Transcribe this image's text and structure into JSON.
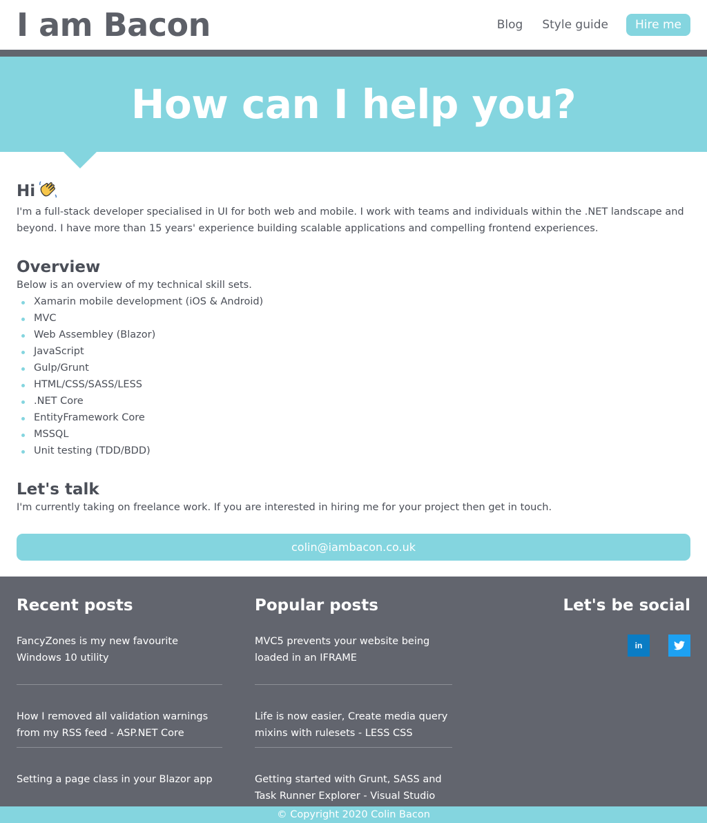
{
  "header": {
    "logo": "I am Bacon",
    "nav": {
      "blog": "Blog",
      "style_guide": "Style guide",
      "hire_me": "Hire me"
    }
  },
  "hero": {
    "title": "How can I help you?"
  },
  "intro": {
    "heading": "Hi",
    "paragraph": "I'm a full-stack developer specialised in UI for both web and mobile. I work with teams and individuals within the .NET landscape and beyond. I have more than 15 years' experience building scalable applications and compelling frontend experiences."
  },
  "overview": {
    "heading": "Overview",
    "lead": "Below is an overview of my technical skill sets.",
    "skills": [
      "Xamarin mobile development (iOS & Android)",
      "MVC",
      "Web Assembley (Blazor)",
      "JavaScript",
      "Gulp/Grunt",
      "HTML/CSS/SASS/LESS",
      ".NET Core",
      "EntityFramework Core",
      "MSSQL",
      "Unit testing (TDD/BDD)"
    ]
  },
  "talk": {
    "heading": "Let's talk",
    "paragraph": "I'm currently taking on freelance work. If you are interested in hiring me for your project then get in touch.",
    "email": "colin@iambacon.co.uk"
  },
  "footer": {
    "recent": {
      "heading": "Recent posts",
      "posts": [
        "FancyZones is my new favourite Windows 10 utility",
        "How I removed all validation warnings from my RSS feed - ASP.NET Core",
        "Setting a page class in your Blazor app"
      ]
    },
    "popular": {
      "heading": "Popular posts",
      "posts": [
        "MVC5 prevents your website being loaded in an IFRAME",
        "Life is now easier, Create media query mixins with rulesets - LESS CSS",
        "Getting started with Grunt, SASS and Task Runner Explorer - Visual Studio"
      ]
    },
    "social": {
      "heading": "Let's be social",
      "icons": [
        "linkedin-icon",
        "twitter-icon"
      ]
    },
    "copyright": "© Copyright 2020 Colin Bacon"
  },
  "colors": {
    "accent": "#84d5df",
    "dark": "#62656e",
    "linkedin": "#0a7cc4",
    "twitter": "#1da1f2"
  }
}
